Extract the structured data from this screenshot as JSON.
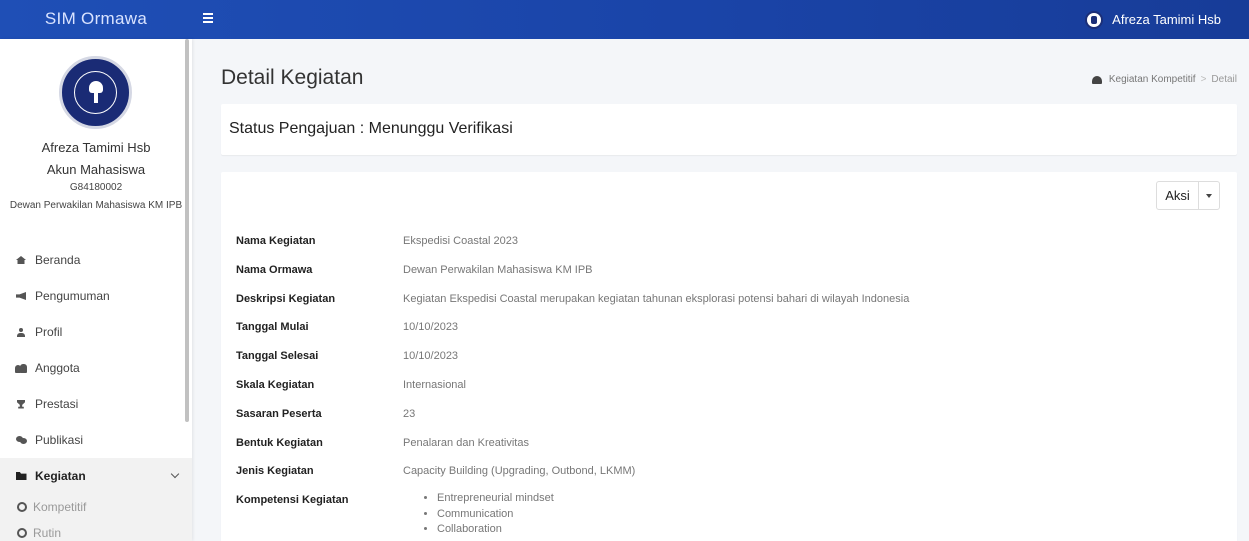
{
  "app": {
    "brand": "SIM Ormawa",
    "user_name": "Afreza Tamimi Hsb"
  },
  "sidebar": {
    "profile": {
      "name": "Afreza Tamimi Hsb",
      "role": "Akun Mahasiswa",
      "nim": "G84180002",
      "org": "Dewan Perwakilan Mahasiswa KM IPB"
    },
    "menu": [
      {
        "label": "Beranda",
        "icon": "home-icon"
      },
      {
        "label": "Pengumuman",
        "icon": "bullhorn-icon"
      },
      {
        "label": "Profil",
        "icon": "user-icon"
      },
      {
        "label": "Anggota",
        "icon": "users-icon"
      },
      {
        "label": "Prestasi",
        "icon": "trophy-icon"
      },
      {
        "label": "Publikasi",
        "icon": "comments-icon"
      },
      {
        "label": "Kegiatan",
        "icon": "folder-icon",
        "active": true
      }
    ],
    "submenu": [
      {
        "label": "Kompetitif"
      },
      {
        "label": "Rutin"
      }
    ]
  },
  "page": {
    "title": "Detail Kegiatan",
    "breadcrumb": {
      "parent": "Kegiatan Kompetitif",
      "separator": ">",
      "current": "Detail"
    },
    "status": "Status Pengajuan : Menunggu Verifikasi",
    "aksi_label": "Aksi"
  },
  "details": [
    {
      "label": "Nama Kegiatan",
      "value": "Ekspedisi Coastal 2023"
    },
    {
      "label": "Nama Ormawa",
      "value": "Dewan Perwakilan Mahasiswa KM IPB"
    },
    {
      "label": "Deskripsi Kegiatan",
      "value": "Kegiatan Ekspedisi Coastal merupakan kegiatan tahunan eksplorasi potensi bahari di wilayah Indonesia"
    },
    {
      "label": "Tanggal Mulai",
      "value": "10/10/2023"
    },
    {
      "label": "Tanggal Selesai",
      "value": "10/10/2023"
    },
    {
      "label": "Skala Kegiatan",
      "value": "Internasional"
    },
    {
      "label": "Sasaran Peserta",
      "value": "23"
    },
    {
      "label": "Bentuk Kegiatan",
      "value": "Penalaran dan Kreativitas"
    },
    {
      "label": "Jenis Kegiatan",
      "value": "Capacity Building (Upgrading, Outbond, LKMM)"
    }
  ],
  "kompetensi": {
    "label": "Kompetensi Kegiatan",
    "items": [
      "Entrepreneurial mindset",
      "Communication",
      "Collaboration"
    ]
  },
  "colors": {
    "topbar": "#1f4fb6",
    "background": "#f4f6f9"
  }
}
